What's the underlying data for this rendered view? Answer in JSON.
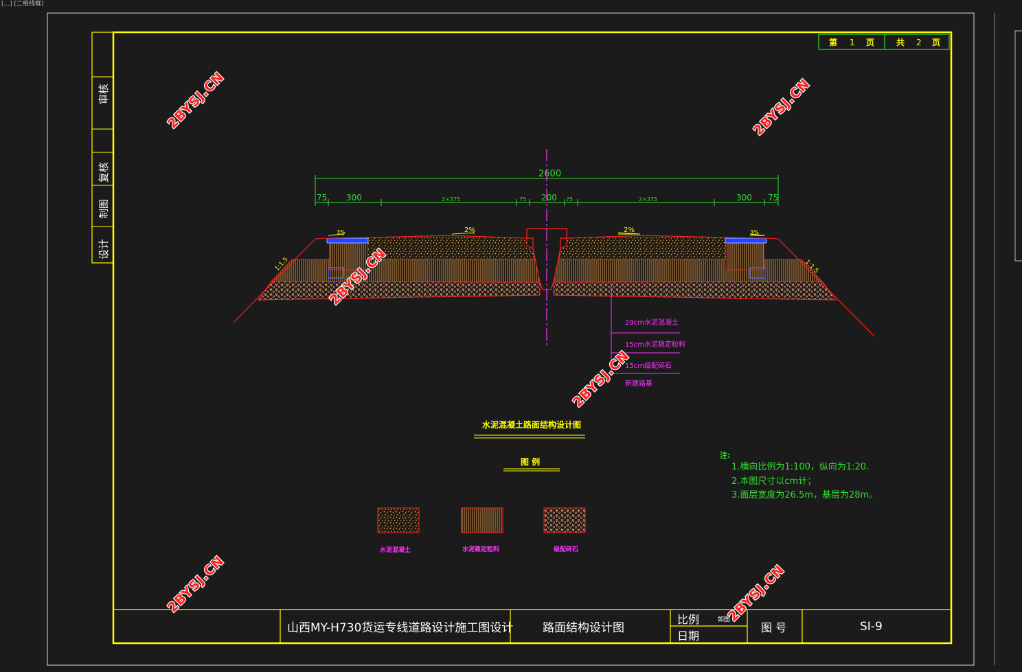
{
  "viewport_label": "[...] [二维线框]",
  "sheet": {
    "page_label_prefix": "第",
    "page_num": "1",
    "page_unit": "页",
    "total_label_prefix": "共",
    "total_pages": "2",
    "total_unit": "页"
  },
  "sidebar": {
    "review": "审核",
    "recheck": "复核",
    "drawing": "制图",
    "design": "设计"
  },
  "dimensions": {
    "total": "2600",
    "parts": [
      "75",
      "300",
      "2×375",
      "75",
      "200",
      "75",
      "2×375",
      "300",
      "75"
    ]
  },
  "slopes": {
    "left_shoulder": "3%",
    "left_lane": "2%",
    "right_lane": "2%",
    "right_shoulder": "3%",
    "left_embankment": "1:1.5",
    "right_embankment": "1:1.5"
  },
  "layers": [
    "29cm水泥混凝土",
    "15cm水泥稳定粒料",
    "15cm级配碎石",
    "新建路基"
  ],
  "figure_title": "水泥混凝土路面结构设计图",
  "legend": {
    "title": "图 例",
    "items": [
      {
        "label": "水泥混凝土",
        "pattern": "concrete"
      },
      {
        "label": "水泥稳定粒料",
        "pattern": "stabilized"
      },
      {
        "label": "级配碎石",
        "pattern": "gravel"
      }
    ]
  },
  "notes": {
    "title": "注:",
    "items": [
      "1.横向比例为1:100，纵向为1:20.",
      "2.本图尺寸以cm计；",
      "3.面层宽度为26.5m，基层为28m。"
    ]
  },
  "title_block": {
    "project": "山西MY-H730货运专线道路设计施工图设计",
    "drawing_name": "路面结构设计图",
    "scale_label": "比例",
    "scale_value": "如图",
    "date_label": "日期",
    "drawing_no_label": "图 号",
    "drawing_no": "SⅠ-9"
  },
  "watermark": "2BYSJ.CN",
  "colors": {
    "frame": "#ffff00",
    "dimension": "#33dd33",
    "layer_label": "#ff33ff",
    "section_outline": "#ff2020",
    "centerline": "#ff33ff",
    "background": "#1b1b1b"
  }
}
